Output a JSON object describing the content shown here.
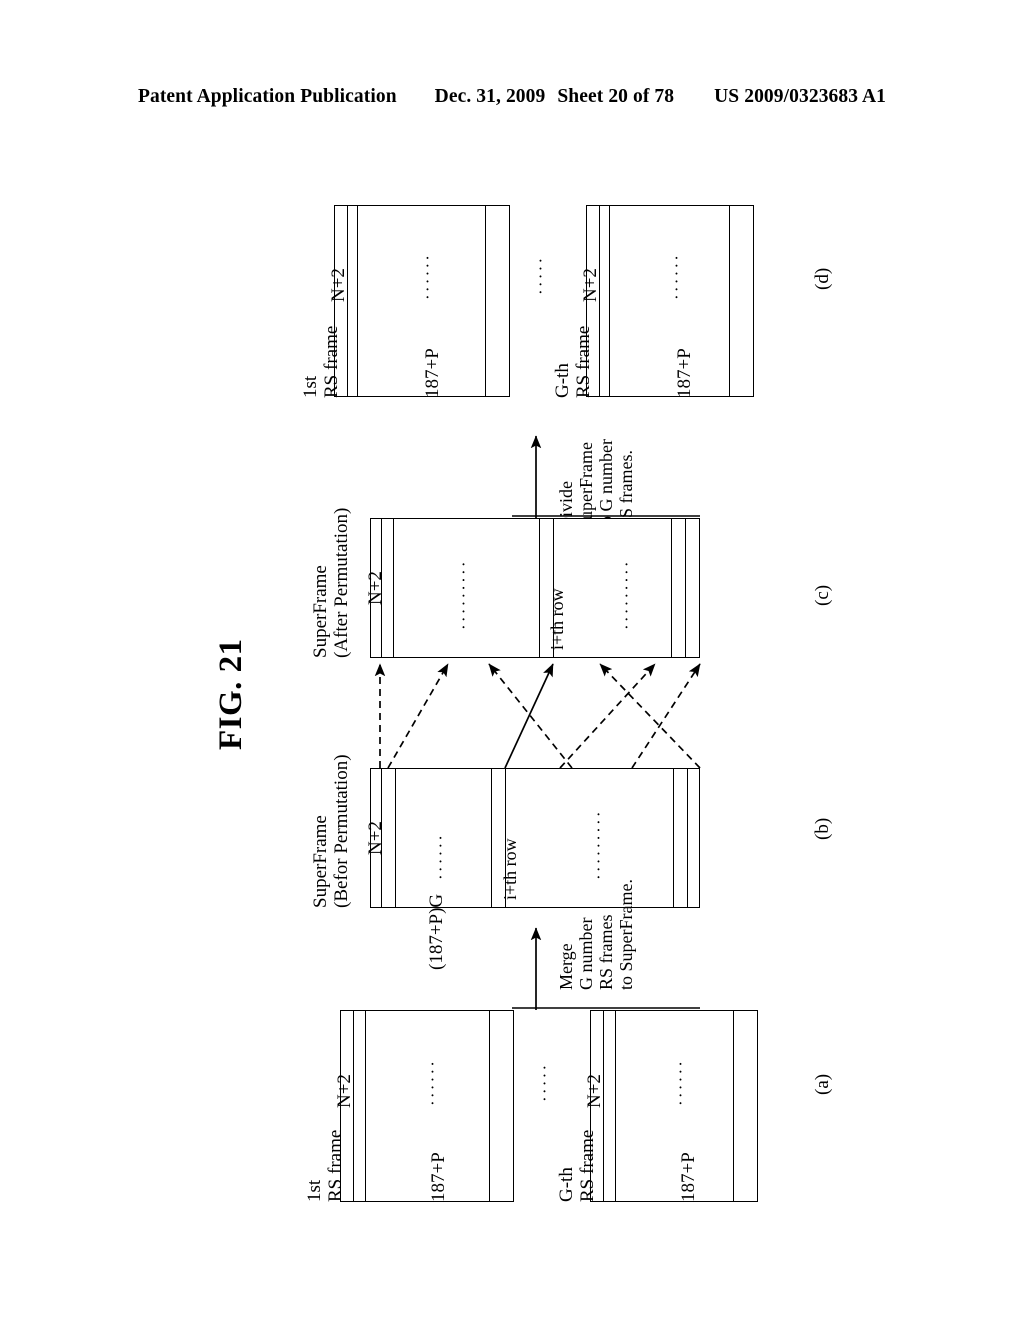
{
  "header": {
    "publication": "Patent Application Publication",
    "date": "Dec. 31, 2009",
    "sheet": "Sheet 20 of 78",
    "number": "US 2009/0323683 A1"
  },
  "figure": {
    "title": "FIG. 21",
    "panels": [
      {
        "id": "a",
        "label": "(a)"
      },
      {
        "id": "b",
        "label": "(b)"
      },
      {
        "id": "c",
        "label": "(c)"
      },
      {
        "id": "d",
        "label": "(d)"
      }
    ]
  },
  "panel_a": {
    "caption": "(a)",
    "frames": [
      {
        "name_line1": "1st",
        "name_line2": "RS frame",
        "height_label": "N+2",
        "width_label": "187+P",
        "dots": "······"
      },
      {
        "name_line1": "G-th",
        "name_line2": "RS frame",
        "height_label": "N+2",
        "width_label": "187+P",
        "dots": "······"
      }
    ],
    "between_dots": "·····"
  },
  "panel_b": {
    "caption": "(b)",
    "title_line1": "SuperFrame",
    "title_line2": "(Befor Permutation)",
    "height_label": "N+2",
    "width_label": "(187+P)G",
    "row_label": "i+th row",
    "dots_left": "······",
    "dots_right": "·········"
  },
  "panel_c": {
    "caption": "(c)",
    "title_line1": "SuperFrame",
    "title_line2": "(After Permutation)",
    "height_label": "N+2",
    "row_label": "i+th row",
    "dots_left": "·········",
    "dots_right": "·········"
  },
  "panel_d": {
    "caption": "(d)",
    "frames": [
      {
        "name_line1": "1st",
        "name_line2": "RS frame",
        "height_label": "N+2",
        "width_label": "187+P",
        "dots": "······"
      },
      {
        "name_line1": "G-th",
        "name_line2": "RS frame",
        "height_label": "N+2",
        "width_label": "187+P",
        "dots": "······"
      }
    ],
    "between_dots": "·····"
  },
  "process_merge": {
    "line1": "Merge",
    "line2": "G number",
    "line3": "RS frames",
    "line4": "to SuperFrame."
  },
  "process_divide": {
    "line1": "Divide",
    "line2": "SuperFrame",
    "line3": "to G number",
    "line4": "RS frames."
  },
  "colors": {
    "ink": "#000000",
    "paper": "#ffffff"
  }
}
